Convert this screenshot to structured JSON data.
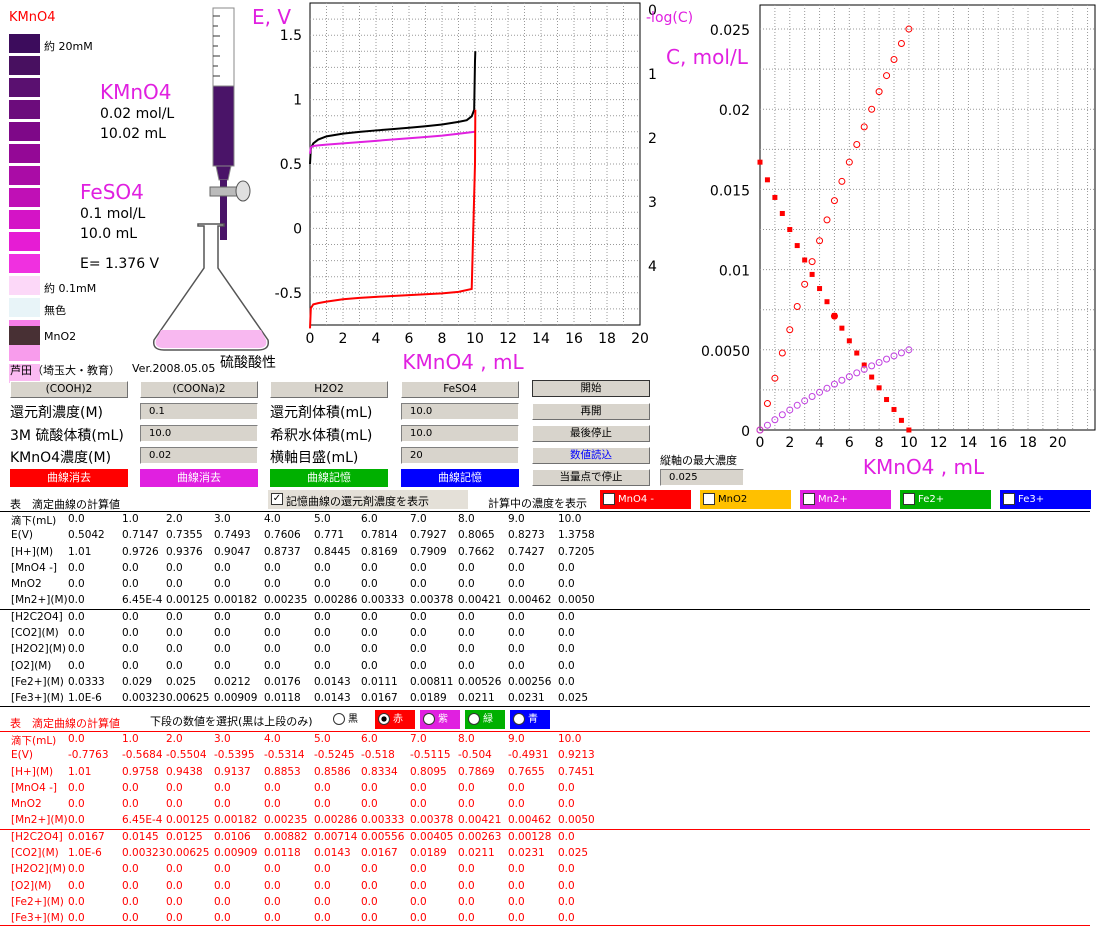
{
  "app": {
    "kmno4_title": "KMnO4",
    "color_scale": {
      "top_label": "約 20mM",
      "bottom_label": "約 0.1mM",
      "colorless_label": "無色",
      "mno2_label": "MnO2",
      "colors": [
        "#3c0c5c",
        "#481060",
        "#5a1070",
        "#6c0c7c",
        "#7e0888",
        "#940896",
        "#aa0ca6",
        "#c010b6",
        "#d414c6",
        "#e61cd4",
        "#f030e0",
        "#f448e2",
        "#f662e4",
        "#f67ee8",
        "#f89cec",
        "#fabaf2",
        "#fcd8f8",
        "#e8f4f8",
        "#483034"
      ]
    },
    "reagent1": {
      "name": "KMnO4",
      "conc": "0.02 mol/L",
      "vol": "10.02 mL"
    },
    "reagent2": {
      "name": "FeSO4",
      "conc": "0.1 mol/L",
      "vol": "10.0 mL"
    },
    "potential": "E= 1.376 V",
    "acidity": "硫酸酸性",
    "author": "芦田（埼玉大・教育）",
    "version": "Ver.2008.05.05",
    "accent_colors": {
      "magenta": "#e020e0",
      "red": "#ff0000",
      "green": "#00b000",
      "blue": "#0000ff",
      "purple": "#c040e0",
      "amber": "#ffc000"
    }
  },
  "controls": {
    "reagent_buttons": [
      "(COOH)2",
      "(COONa)2",
      "H2O2",
      "FeSO4"
    ],
    "start_button": "開始",
    "resume_button": "再開",
    "stop_last_button": "最後停止",
    "read_button": "数値読込",
    "eq_stop_button": "当量点で停止",
    "max_axis_label": "縦軸の最大濃度",
    "max_axis_value": "0.025",
    "reductant_conc_label": "還元剤濃度(M)",
    "reductant_conc_value": "0.1",
    "h2so4_label": "3M 硫酸体積(mL)",
    "h2so4_value": "10.0",
    "kmno4_conc_label": "KMnO4濃度(M)",
    "kmno4_conc_value": "0.02",
    "reductant_vol_label": "還元剤体積(mL)",
    "reductant_vol_value": "10.0",
    "dilution_label": "希釈水体積(mL)",
    "dilution_value": "10.0",
    "x_scale_label": "横軸目盛(mL)",
    "x_scale_value": "20",
    "erase_buttons": [
      "曲線消去",
      "曲線消去"
    ],
    "store_buttons": [
      "曲線記憶",
      "曲線記憶"
    ],
    "show_stored_label": "記憶曲線の還元剤濃度を表示",
    "show_conc_label": "計算中の濃度を表示",
    "species_checks": [
      {
        "label": "MnO4 -",
        "color": "#ff0000",
        "text": "#ffffff"
      },
      {
        "label": "MnO2",
        "color": "#ffc000",
        "text": "#000000"
      },
      {
        "label": "Mn2+",
        "color": "#e020e0",
        "text": "#ffffff"
      },
      {
        "label": "Fe2+",
        "color": "#00b000",
        "text": "#ffffff"
      },
      {
        "label": "Fe3+",
        "color": "#0000ff",
        "text": "#ffffff"
      }
    ],
    "lower_select_label": "下段の数値を選択(黒は上段のみ)",
    "radio_options": [
      {
        "label": "黒",
        "color": "#ffffff",
        "text": "#000000"
      },
      {
        "label": "赤",
        "color": "#ff0000",
        "text": "#ffffff"
      },
      {
        "label": "紫",
        "color": "#e020e0",
        "text": "#ffffff"
      },
      {
        "label": "緑",
        "color": "#00b000",
        "text": "#ffffff"
      },
      {
        "label": "青",
        "color": "#0000ff",
        "text": "#ffffff"
      }
    ]
  },
  "chart_data": [
    {
      "type": "line",
      "title": "",
      "ylabel_left": "E, V",
      "ylabel_right": "-log(C)",
      "xlabel": "KMnO4 , mL",
      "xlim": [
        0,
        20
      ],
      "ylim": [
        -0.75,
        1.75
      ],
      "x_ticks": [
        "0",
        "2",
        "4",
        "6",
        "8",
        "10",
        "12",
        "14",
        "16",
        "18",
        "20"
      ],
      "y_ticks": [
        "1.5",
        "1",
        "0.5",
        "0",
        "-0.5"
      ],
      "right_ticks": [
        "0",
        "1",
        "2",
        "3",
        "4"
      ],
      "grid": true,
      "series": [
        {
          "color": "#000000",
          "x": [
            0,
            0.05,
            0.2,
            0.5,
            1,
            2,
            3,
            4,
            5,
            6,
            7,
            8,
            9,
            9.5,
            9.8,
            9.95,
            10,
            10.02
          ],
          "y": [
            0.5,
            0.62,
            0.66,
            0.69,
            0.7147,
            0.7355,
            0.7493,
            0.7606,
            0.771,
            0.7814,
            0.7927,
            0.8065,
            0.8273,
            0.84,
            0.87,
            0.92,
            1.3,
            1.3758
          ]
        },
        {
          "color": "#e020e0",
          "x": [
            0,
            0.05,
            0.2,
            0.5,
            1,
            2,
            3,
            4,
            5,
            6,
            7,
            8,
            9,
            10
          ],
          "y": [
            0.58,
            0.63,
            0.64,
            0.645,
            0.65,
            0.66,
            0.67,
            0.68,
            0.69,
            0.7,
            0.71,
            0.72,
            0.735,
            0.75
          ]
        },
        {
          "color": "#ff0000",
          "x": [
            0,
            0.05,
            0.2,
            0.5,
            1,
            2,
            3,
            4,
            5,
            6,
            7,
            8,
            9,
            9.8,
            10,
            10.02
          ],
          "y": [
            -0.7763,
            -0.62,
            -0.59,
            -0.58,
            -0.5684,
            -0.5504,
            -0.5395,
            -0.5314,
            -0.5245,
            -0.518,
            -0.5115,
            -0.504,
            -0.4931,
            -0.47,
            0.5,
            0.9213
          ]
        }
      ]
    },
    {
      "type": "scatter",
      "title": "",
      "ylabel": "C, mol/L",
      "xlabel": "KMnO4 , mL",
      "xlim": [
        0,
        22.5
      ],
      "ylim": [
        0,
        0.0265
      ],
      "x_ticks": [
        "0",
        "2",
        "4",
        "6",
        "8",
        "10",
        "12",
        "14",
        "16",
        "18",
        "20"
      ],
      "y_ticks": [
        "0.025",
        "0.02",
        "0.015",
        "0.01",
        "0.0050",
        "0"
      ],
      "grid": true,
      "series": [
        {
          "marker": "square-filled",
          "color": "#ff0000",
          "x": [
            0,
            0.5,
            1,
            1.5,
            2,
            2.5,
            3,
            3.5,
            4,
            4.5,
            5,
            5.5,
            6,
            6.5,
            7,
            7.5,
            8,
            8.5,
            9,
            9.5,
            10
          ],
          "y": [
            0.0167,
            0.0156,
            0.0145,
            0.0135,
            0.0125,
            0.0115,
            0.0106,
            0.0097,
            0.00882,
            0.008,
            0.00714,
            0.00635,
            0.00556,
            0.0048,
            0.00405,
            0.0033,
            0.00263,
            0.0019,
            0.00128,
            0.0006,
            0.0
          ]
        },
        {
          "marker": "circle-open",
          "color": "#ff0000",
          "x": [
            0,
            0.5,
            1,
            1.5,
            2,
            2.5,
            3,
            3.5,
            4,
            4.5,
            5,
            5.5,
            6,
            6.5,
            7,
            7.5,
            8,
            8.5,
            9,
            9.5,
            10
          ],
          "y": [
            0.0,
            0.00165,
            0.00323,
            0.0048,
            0.00625,
            0.0077,
            0.00909,
            0.0105,
            0.0118,
            0.0131,
            0.0143,
            0.0155,
            0.0167,
            0.0178,
            0.0189,
            0.02,
            0.0211,
            0.0221,
            0.0231,
            0.0241,
            0.025
          ]
        },
        {
          "marker": "circle-open",
          "color": "#c040e0",
          "x": [
            0,
            0.5,
            1,
            1.5,
            2,
            2.5,
            3,
            3.5,
            4,
            4.5,
            5,
            5.5,
            6,
            6.5,
            7,
            7.5,
            8,
            8.5,
            9,
            9.5,
            10
          ],
          "y": [
            0.0,
            0.0003,
            0.00064,
            0.00095,
            0.00125,
            0.00154,
            0.00182,
            0.00209,
            0.00235,
            0.0026,
            0.00286,
            0.0031,
            0.00333,
            0.00356,
            0.00378,
            0.004,
            0.00421,
            0.00442,
            0.00462,
            0.00481,
            0.005
          ]
        },
        {
          "marker": "circle-filled",
          "color": "#ff0000",
          "x": [
            5
          ],
          "y": [
            0.0071
          ]
        }
      ]
    }
  ],
  "table1": {
    "title": "表　滴定曲線の計算値",
    "rows": [
      {
        "label": "滴下(mL)",
        "values": [
          "0.0",
          "1.0",
          "2.0",
          "3.0",
          "4.0",
          "5.0",
          "6.0",
          "7.0",
          "8.0",
          "9.0",
          "10.0"
        ]
      },
      {
        "label": "E(V)",
        "values": [
          "0.5042",
          "0.7147",
          "0.7355",
          "0.7493",
          "0.7606",
          "0.771",
          "0.7814",
          "0.7927",
          "0.8065",
          "0.8273",
          "1.3758"
        ]
      },
      {
        "label": "[H+](M)",
        "values": [
          "1.01",
          "0.9726",
          "0.9376",
          "0.9047",
          "0.8737",
          "0.8445",
          "0.8169",
          "0.7909",
          "0.7662",
          "0.7427",
          "0.7205"
        ]
      },
      {
        "label": "[MnO4 -]",
        "values": [
          "0.0",
          "0.0",
          "0.0",
          "0.0",
          "0.0",
          "0.0",
          "0.0",
          "0.0",
          "0.0",
          "0.0",
          "0.0"
        ]
      },
      {
        "label": "MnO2",
        "values": [
          "0.0",
          "0.0",
          "0.0",
          "0.0",
          "0.0",
          "0.0",
          "0.0",
          "0.0",
          "0.0",
          "0.0",
          "0.0"
        ]
      },
      {
        "label": "[Mn2+](M)",
        "values": [
          "0.0",
          "6.45E-4",
          "0.00125",
          "0.00182",
          "0.00235",
          "0.00286",
          "0.00333",
          "0.00378",
          "0.00421",
          "0.00462",
          "0.0050"
        ]
      },
      {
        "label": "[H2C2O4]",
        "values": [
          "0.0",
          "0.0",
          "0.0",
          "0.0",
          "0.0",
          "0.0",
          "0.0",
          "0.0",
          "0.0",
          "0.0",
          "0.0"
        ]
      },
      {
        "label": "[CO2](M)",
        "values": [
          "0.0",
          "0.0",
          "0.0",
          "0.0",
          "0.0",
          "0.0",
          "0.0",
          "0.0",
          "0.0",
          "0.0",
          "0.0"
        ]
      },
      {
        "label": "[H2O2](M)",
        "values": [
          "0.0",
          "0.0",
          "0.0",
          "0.0",
          "0.0",
          "0.0",
          "0.0",
          "0.0",
          "0.0",
          "0.0",
          "0.0"
        ]
      },
      {
        "label": "[O2](M)",
        "values": [
          "0.0",
          "0.0",
          "0.0",
          "0.0",
          "0.0",
          "0.0",
          "0.0",
          "0.0",
          "0.0",
          "0.0",
          "0.0"
        ]
      },
      {
        "label": "[Fe2+](M)",
        "values": [
          "0.0333",
          "0.029",
          "0.025",
          "0.0212",
          "0.0176",
          "0.0143",
          "0.0111",
          "0.00811",
          "0.00526",
          "0.00256",
          "0.0"
        ]
      },
      {
        "label": "[Fe3+](M)",
        "values": [
          "1.0E-6",
          "0.00323",
          "0.00625",
          "0.00909",
          "0.0118",
          "0.0143",
          "0.0167",
          "0.0189",
          "0.0211",
          "0.0231",
          "0.025"
        ]
      }
    ]
  },
  "table2": {
    "title": "表　滴定曲線の計算値",
    "rows": [
      {
        "label": "滴下(mL)",
        "values": [
          "0.0",
          "1.0",
          "2.0",
          "3.0",
          "4.0",
          "5.0",
          "6.0",
          "7.0",
          "8.0",
          "9.0",
          "10.0"
        ]
      },
      {
        "label": "E(V)",
        "values": [
          "-0.7763",
          "-0.5684",
          "-0.5504",
          "-0.5395",
          "-0.5314",
          "-0.5245",
          "-0.518",
          "-0.5115",
          "-0.504",
          "-0.4931",
          "0.9213"
        ]
      },
      {
        "label": "[H+](M)",
        "values": [
          "1.01",
          "0.9758",
          "0.9438",
          "0.9137",
          "0.8853",
          "0.8586",
          "0.8334",
          "0.8095",
          "0.7869",
          "0.7655",
          "0.7451"
        ]
      },
      {
        "label": "[MnO4 -]",
        "values": [
          "0.0",
          "0.0",
          "0.0",
          "0.0",
          "0.0",
          "0.0",
          "0.0",
          "0.0",
          "0.0",
          "0.0",
          "0.0"
        ]
      },
      {
        "label": "MnO2",
        "values": [
          "0.0",
          "0.0",
          "0.0",
          "0.0",
          "0.0",
          "0.0",
          "0.0",
          "0.0",
          "0.0",
          "0.0",
          "0.0"
        ]
      },
      {
        "label": "[Mn2+](M)",
        "values": [
          "0.0",
          "6.45E-4",
          "0.00125",
          "0.00182",
          "0.00235",
          "0.00286",
          "0.00333",
          "0.00378",
          "0.00421",
          "0.00462",
          "0.0050"
        ]
      },
      {
        "label": "[H2C2O4]",
        "values": [
          "0.0167",
          "0.0145",
          "0.0125",
          "0.0106",
          "0.00882",
          "0.00714",
          "0.00556",
          "0.00405",
          "0.00263",
          "0.00128",
          "0.0"
        ]
      },
      {
        "label": "[CO2](M)",
        "values": [
          "1.0E-6",
          "0.00323",
          "0.00625",
          "0.00909",
          "0.0118",
          "0.0143",
          "0.0167",
          "0.0189",
          "0.0211",
          "0.0231",
          "0.025"
        ]
      },
      {
        "label": "[H2O2](M)",
        "values": [
          "0.0",
          "0.0",
          "0.0",
          "0.0",
          "0.0",
          "0.0",
          "0.0",
          "0.0",
          "0.0",
          "0.0",
          "0.0"
        ]
      },
      {
        "label": "[O2](M)",
        "values": [
          "0.0",
          "0.0",
          "0.0",
          "0.0",
          "0.0",
          "0.0",
          "0.0",
          "0.0",
          "0.0",
          "0.0",
          "0.0"
        ]
      },
      {
        "label": "[Fe2+](M)",
        "values": [
          "0.0",
          "0.0",
          "0.0",
          "0.0",
          "0.0",
          "0.0",
          "0.0",
          "0.0",
          "0.0",
          "0.0",
          "0.0"
        ]
      },
      {
        "label": "[Fe3+](M)",
        "values": [
          "0.0",
          "0.0",
          "0.0",
          "0.0",
          "0.0",
          "0.0",
          "0.0",
          "0.0",
          "0.0",
          "0.0",
          "0.0"
        ]
      }
    ]
  }
}
